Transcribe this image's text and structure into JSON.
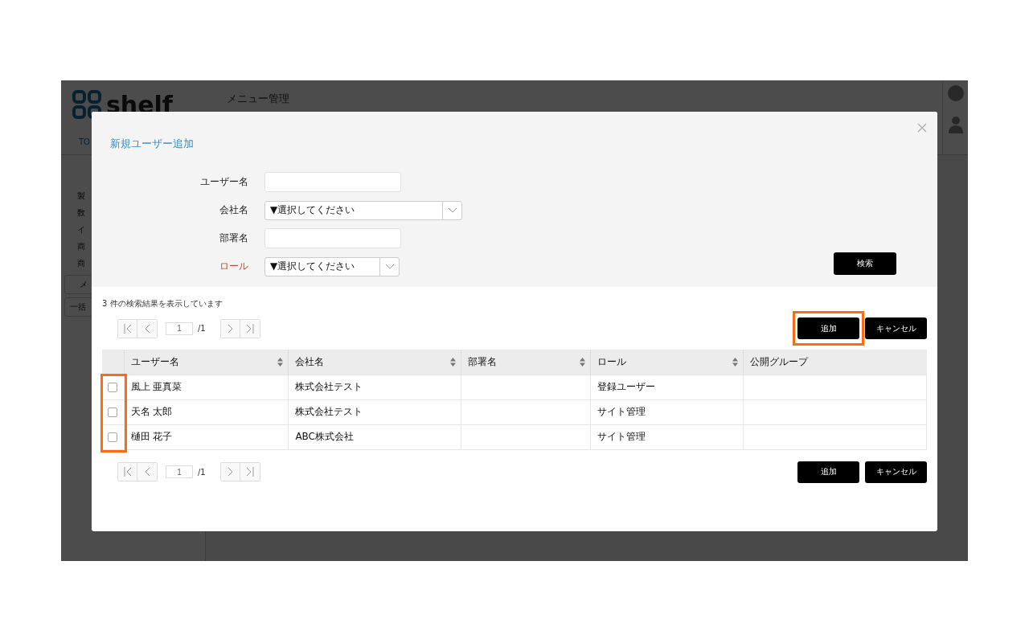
{
  "app": {
    "logo": "shelf",
    "page_title": "メニュー管理",
    "nav_tab": "TO",
    "sidebar_items": [
      "製",
      "数",
      "イ",
      "商",
      "商"
    ],
    "add_menu": "メ",
    "bulk_register": "一括"
  },
  "dialog": {
    "title": "新規ユーザー追加",
    "form": [
      {
        "kind": "text",
        "label": "ユーザー名",
        "emphasis": false
      },
      {
        "kind": "select",
        "label": "会社名",
        "value": "▼選択してください",
        "emphasis": false
      },
      {
        "kind": "text",
        "label": "部署名",
        "emphasis": false
      },
      {
        "kind": "select",
        "label": "ロール",
        "value": "▼選択してください",
        "emphasis": true
      }
    ],
    "search_button": "検索",
    "result_text": "3 件の検索結果を表示しています",
    "pagers": [
      {
        "page": "1",
        "total": "/1"
      },
      {
        "page": "1",
        "total": "/1"
      }
    ],
    "action_rows": [
      {
        "add": "追加",
        "cancel": "キャンセル",
        "add_highlighted": true
      },
      {
        "add": "追加",
        "cancel": "キャンセル",
        "add_highlighted": false
      }
    ],
    "table": {
      "checkbox_column_highlighted": true,
      "columns": [
        {
          "label": "ユーザー名",
          "sortable": true
        },
        {
          "label": "会社名",
          "sortable": true
        },
        {
          "label": "部署名",
          "sortable": true
        },
        {
          "label": "ロール",
          "sortable": true
        },
        {
          "label": "公開グループ",
          "sortable": false
        }
      ],
      "rows": [
        {
          "checked": false,
          "cells": [
            "風上 亜真菜",
            "株式会社テスト",
            "",
            "登録ユーザー",
            ""
          ]
        },
        {
          "checked": false,
          "cells": [
            "天名 太郎",
            "株式会社テスト",
            "",
            "サイト管理",
            ""
          ]
        },
        {
          "checked": false,
          "cells": [
            "樋田 花子",
            "ABC株式会社",
            "",
            "サイト管理",
            ""
          ]
        }
      ]
    }
  }
}
